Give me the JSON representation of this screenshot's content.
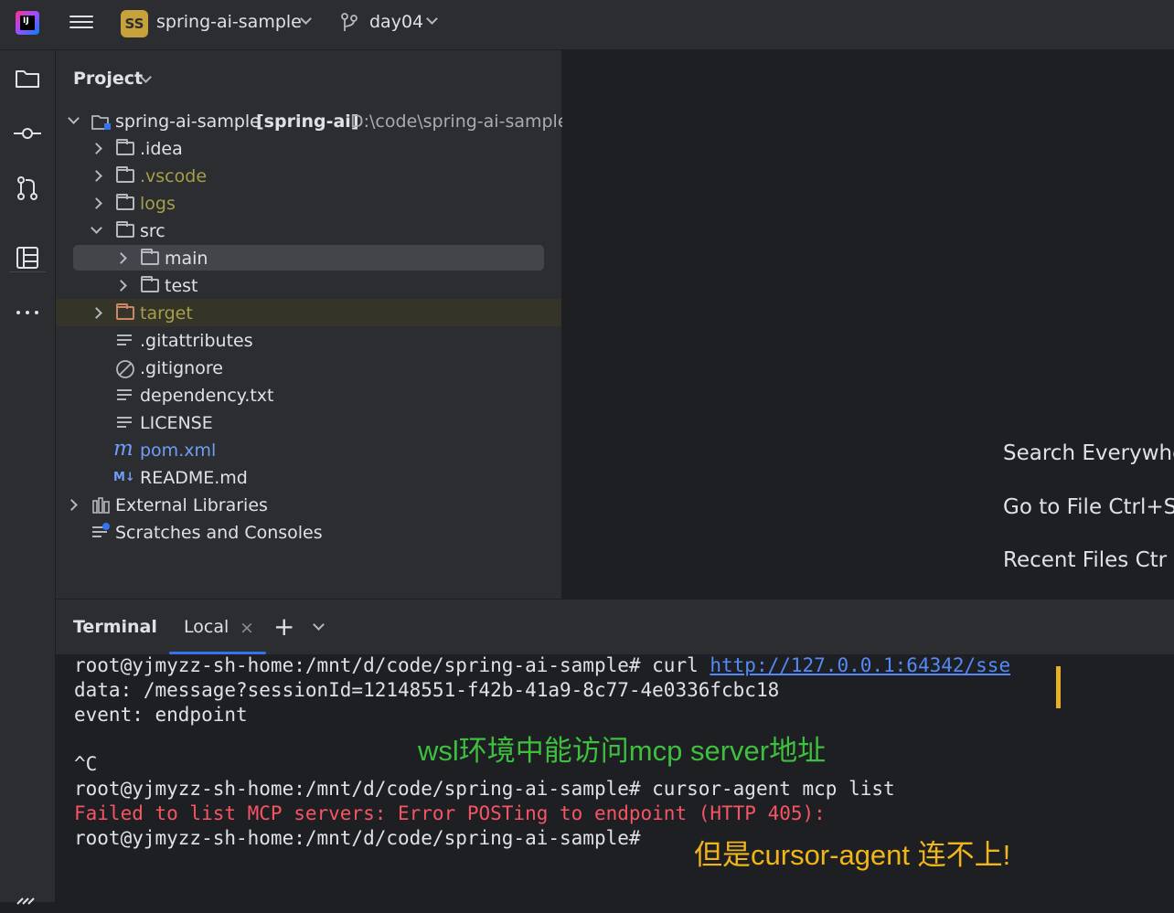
{
  "topbar": {
    "app_logo_text": "IJ",
    "project_badge": "SS",
    "project_name": "spring-ai-sample",
    "branch_name": "day04"
  },
  "project_panel": {
    "title": "Project",
    "root": {
      "name": "spring-ai-sample",
      "module": "[spring-ai]",
      "path": "D:\\code\\spring-ai-sample"
    },
    "items": [
      {
        "label": ".idea"
      },
      {
        "label": ".vscode"
      },
      {
        "label": "logs"
      },
      {
        "label": "src"
      },
      {
        "label": "main"
      },
      {
        "label": "test"
      },
      {
        "label": "target"
      },
      {
        "label": ".gitattributes"
      },
      {
        "label": ".gitignore"
      },
      {
        "label": "dependency.txt"
      },
      {
        "label": "LICENSE"
      },
      {
        "label": "pom.xml"
      },
      {
        "label": "README.md"
      },
      {
        "label": "External Libraries"
      },
      {
        "label": "Scratches and Consoles"
      }
    ],
    "colors": {
      "ignored": "#a79f49",
      "excluded_folder": "#d0856b",
      "selected_row": "#43454a",
      "maven_file": "#6f9ef8"
    }
  },
  "editor_hints": [
    {
      "label": "Search Everywhe"
    },
    {
      "label": "Go to File  Ctrl+S"
    },
    {
      "label": "Recent Files  Ctr"
    }
  ],
  "terminal": {
    "title": "Terminal",
    "tab_label": "Local",
    "lines": {
      "l1_prompt": "root@yjmyzz-sh-home:/mnt/d/code/spring-ai-sample# curl ",
      "l1_url": "http://127.0.0.1:64342/sse",
      "l2": "data: /message?sessionId=12148551-f42b-41a9-8c77-4e0336fcbc18",
      "l3": "event: endpoint",
      "l4": "^C",
      "l5": "root@yjmyzz-sh-home:/mnt/d/code/spring-ai-sample# cursor-agent mcp list",
      "l6": "Failed to list MCP servers: Error POSTing to endpoint (HTTP 405):",
      "l7": "root@yjmyzz-sh-home:/mnt/d/code/spring-ai-sample#"
    },
    "annotations": {
      "green": "wsl环境中能访问mcp server地址",
      "yellow": "但是cursor-agent 连不上!"
    },
    "colors": {
      "error": "#f75464",
      "link": "#548af7",
      "annotation_green": "#3fbf3f",
      "annotation_yellow": "#f0b619",
      "cursor": "#e8b123"
    }
  }
}
